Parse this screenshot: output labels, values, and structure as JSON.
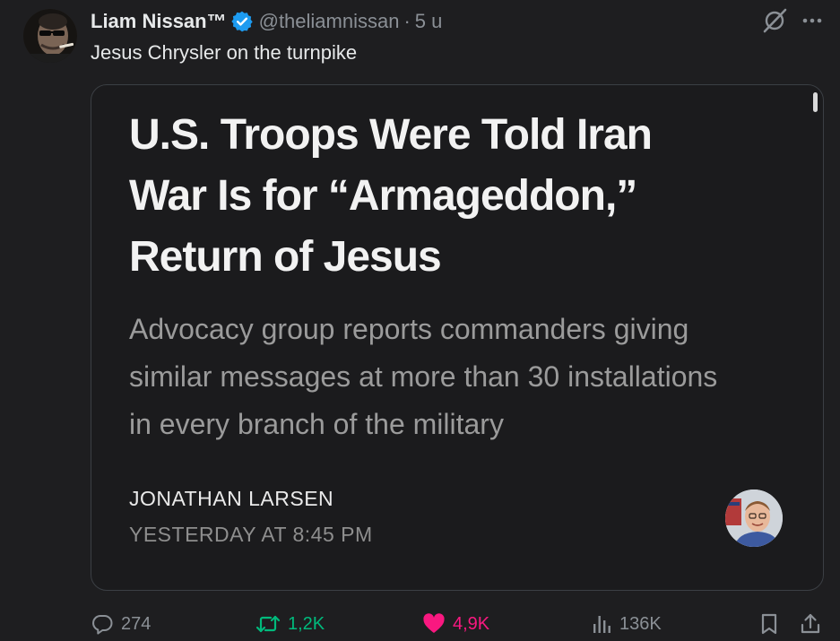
{
  "tweet": {
    "author": {
      "display_name": "Liam Nissan™",
      "handle": "@theliamnissan",
      "time": "5 u",
      "verified": true
    },
    "separator": "·",
    "text": "Jesus Chrysler on the turnpike"
  },
  "media": {
    "headline_lines": [
      "U.S. Troops Were Told Iran",
      "War Is for “Armageddon,”",
      "Return of Jesus"
    ],
    "subhead_lines": [
      "Advocacy group reports commanders giving",
      "similar messages at more than 30 installations",
      "in every branch of the military"
    ],
    "byline": "JONATHAN LARSEN",
    "dateline": "YESTERDAY AT 8:45 PM"
  },
  "actions": {
    "replies": "274",
    "reposts": "1,2K",
    "likes": "4,9K",
    "views": "136K"
  },
  "colors": {
    "background": "#1e1e20",
    "verified_blue": "#1d9bf0",
    "repost_green": "#00ba7c",
    "like_pink": "#f91880",
    "muted_text": "#8b9096"
  },
  "icons": {
    "verified": "verified-badge-icon",
    "grok": "grok-icon",
    "more": "more-icon",
    "reply": "reply-icon",
    "repost": "repost-icon",
    "like": "heart-icon",
    "views": "views-icon",
    "bookmark": "bookmark-icon",
    "share": "share-icon"
  }
}
